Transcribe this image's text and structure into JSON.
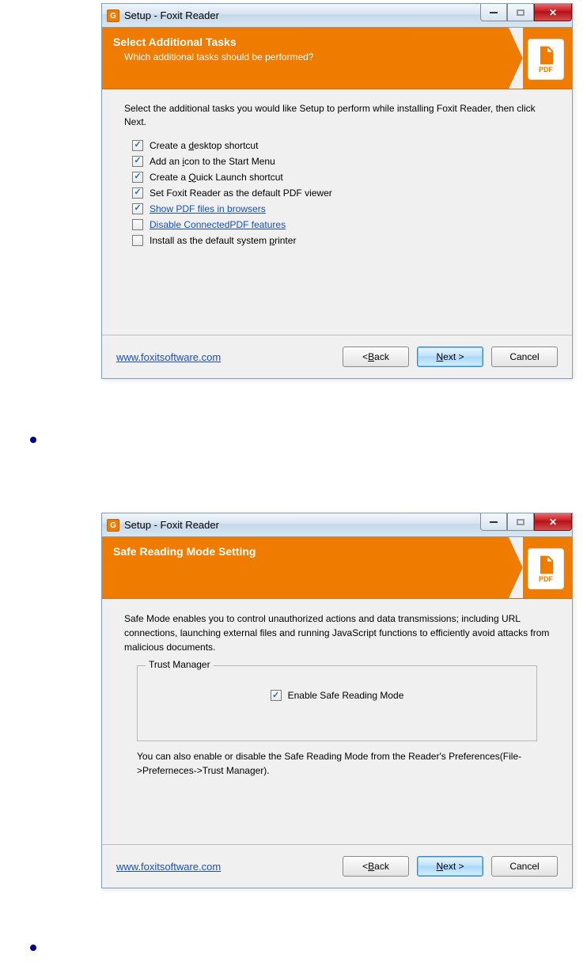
{
  "dialog1": {
    "title": "Setup - Foxit Reader",
    "header_title": "Select Additional Tasks",
    "header_sub": "Which additional tasks should be performed?",
    "pdf_label": "PDF",
    "intro": "Select the additional tasks you would like Setup to perform while installing Foxit Reader, then click Next.",
    "checks": {
      "c1": "Create a desktop shortcut",
      "c2": "Add an icon to the Start Menu",
      "c3": "Create a Quick Launch shortcut",
      "c4": "Set Foxit Reader as the default PDF viewer",
      "c5": "Show PDF files in browsers",
      "c6": "Disable ConnectedPDF features",
      "c7": "Install as the default system printer"
    },
    "footer_link": "www.foxitsoftware.com",
    "btn_back": "< Back",
    "btn_next": "Next >",
    "btn_cancel": "Cancel"
  },
  "dialog2": {
    "title": "Setup - Foxit Reader",
    "header_title": "Safe Reading Mode Setting",
    "pdf_label": "PDF",
    "intro": "Safe Mode enables you to control unauthorized actions and data transmissions; including URL connections, launching external files and running JavaScript functions to efficiently avoid attacks from malicious documents.",
    "fieldset_legend": "Trust Manager",
    "safe_label": "Enable Safe Reading Mode",
    "post_note": "You can also enable or disable the Safe Reading Mode from the Reader's Preferences(File->Preferneces->Trust Manager).",
    "footer_link": "www.foxitsoftware.com",
    "btn_back": "< Back",
    "btn_next": "Next >",
    "btn_cancel": "Cancel"
  }
}
